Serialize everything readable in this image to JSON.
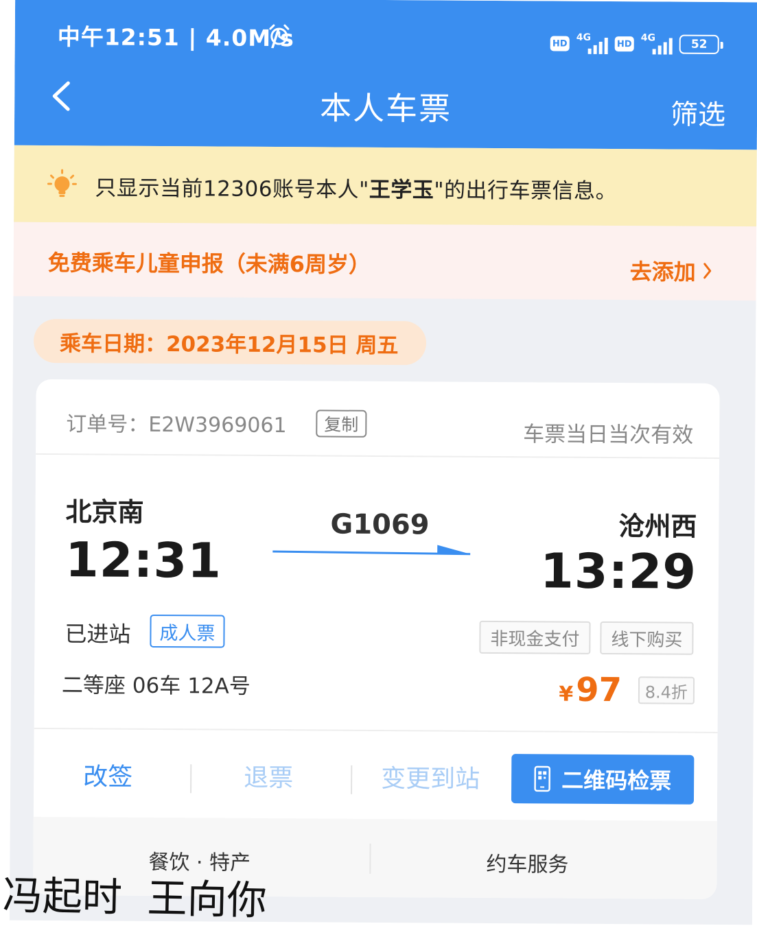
{
  "status_bar": {
    "time": "中午12:51 | 4.0M/s",
    "hd": "HD",
    "network": "4G",
    "battery": "52"
  },
  "nav": {
    "title": "本人车票",
    "filter_label": "筛选"
  },
  "notice": {
    "prefix": "只显示当前12306账号本人\"",
    "name": "王学玉",
    "suffix": "\"的出行车票信息。"
  },
  "child_declaration": {
    "title": "免费乘车儿童申报（未满6周岁）",
    "action_label": "去添加"
  },
  "ride_date": "乘车日期：2023年12月15日 周五",
  "ticket": {
    "order_label": "订单号：E2W3969061",
    "copy_label": "复制",
    "validity": "车票当日当次有效",
    "from_station": "北京南",
    "depart_time": "12:31",
    "train_no": "G1069",
    "to_station": "沧州西",
    "arrive_time": "13:29",
    "status": "已进站",
    "ticket_type": "成人票",
    "payment_tags": [
      "非现金支付",
      "线下购买"
    ],
    "seat": "二等座 06车 12A号",
    "price_symbol": "¥",
    "price": "97",
    "discount": "8.4折"
  },
  "actions": {
    "change": "改签",
    "refund": "退票",
    "change_station": "变更到站",
    "qr_check": "二维码检票"
  },
  "services": {
    "food": "餐饮 · 特产",
    "car": "约车服务"
  },
  "handwriting": "冯起时  王向你",
  "colors": {
    "header_blue": "#3a8ef0",
    "accent_orange": "#ef6d12",
    "notice_yellow": "#fbeebc"
  }
}
